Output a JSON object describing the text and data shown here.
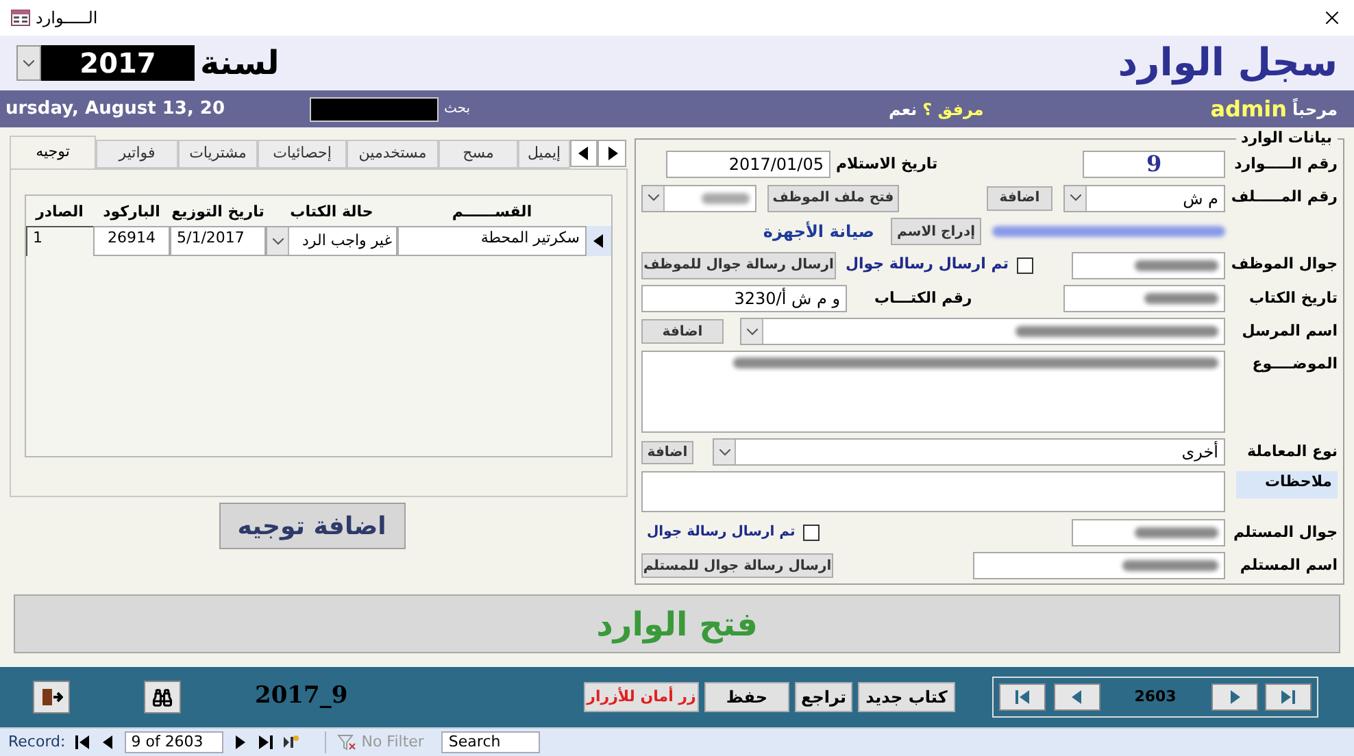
{
  "window": {
    "title": "الـــــوارد"
  },
  "header": {
    "title": "سجل الوارد",
    "year_label": "لسنة",
    "year": "2017"
  },
  "info_bar": {
    "date": "ursday, August 13, 20",
    "search_label": "بحث",
    "attachment_label": "مرفق ؟",
    "attachment_value": "نعم",
    "welcome": "مرحباً",
    "user": "admin"
  },
  "tabs": [
    {
      "label": "إيميل",
      "selected": false
    },
    {
      "label": "مسح",
      "selected": false
    },
    {
      "label": "مستخدمين",
      "selected": false
    },
    {
      "label": "إحصائيات",
      "selected": false
    },
    {
      "label": "مشتريات",
      "selected": false
    },
    {
      "label": "فواتير",
      "selected": false
    },
    {
      "label": "توجيه",
      "selected": true
    }
  ],
  "routing_table": {
    "columns": [
      "القســــــم",
      "حالة الكتاب",
      "تاريخ التوزيع",
      "الباركود",
      "الصادر"
    ],
    "rows": [
      {
        "section": "سكرتير المحطة",
        "status": "غير واجب الرد",
        "date": "5/1/2017",
        "barcode": "26914",
        "outgoing": "1"
      }
    ]
  },
  "add_routing_button": "اضافة توجيه",
  "incoming_form": {
    "legend": "بيانات الوارد",
    "incoming_no": {
      "label": "رقم الـــــوارد",
      "value": "9"
    },
    "received_date": {
      "label": "تاريخ الاستلام",
      "value": "2017/01/05"
    },
    "file_no": {
      "label": "رقم المـــــلف",
      "value": "م ش"
    },
    "file_add_button": "اضافة",
    "open_employee_file_button": "فتح ملف الموظف",
    "insert_name_button": "إدراج الاسم",
    "department": "صيانة الأجهزة",
    "employee_mobile": {
      "label": "جوال الموظف"
    },
    "employee_sms_sent": {
      "label": "تم ارسال رسالة جوال",
      "checked": false
    },
    "send_employee_sms_button": "ارسال رسالة جوال للموظف",
    "letter_date": {
      "label": "تاريخ الكتاب"
    },
    "letter_no": {
      "label": "رقم الكتـــاب",
      "value": "و م ش أ/3230"
    },
    "sender": {
      "label": "اسم المرسل"
    },
    "sender_add_button": "اضافة",
    "subject": {
      "label": "الموضــــوع"
    },
    "transaction_type": {
      "label": "نوع المعاملة",
      "value": "أخرى"
    },
    "transaction_add_button": "اضافة",
    "notes": {
      "label": "ملاحظات"
    },
    "recipient_mobile": {
      "label": "جوال المستلم"
    },
    "recipient_sms_sent": {
      "label": "تم ارسال رسالة جوال",
      "checked": false
    },
    "recipient_name": {
      "label": "اسم المستلم"
    },
    "send_recipient_sms_button": "ارسال رسالة جوال للمستلم"
  },
  "open_incoming_button": "فتح الوارد",
  "toolbar": {
    "record_code": "2017_9",
    "safety_button": "زر أمان للأزرار",
    "save_button": "حفظ",
    "undo_button": "تراجع",
    "new_button": "كتاب جديد",
    "record_count": "2603"
  },
  "record_nav": {
    "label": "Record:",
    "position": "9 of 2603",
    "filter": "No Filter",
    "search_placeholder": "Search"
  }
}
